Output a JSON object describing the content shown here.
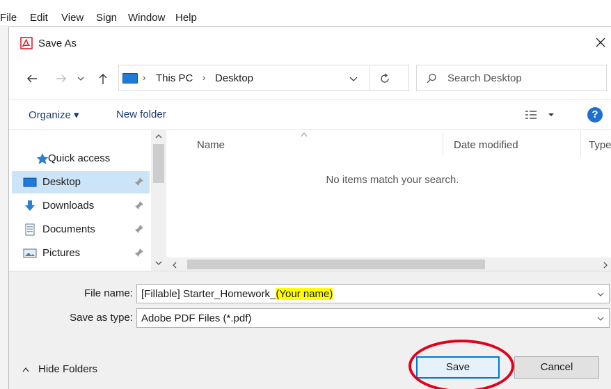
{
  "app_menu": [
    "File",
    "Edit",
    "View",
    "Sign",
    "Window",
    "Help"
  ],
  "dialog": {
    "title": "Save As",
    "icon": "pdf-icon"
  },
  "address": {
    "crumbs": [
      "This PC",
      "Desktop"
    ],
    "search_placeholder": "Search Desktop"
  },
  "toolbar": {
    "organize": "Organize ▾",
    "new_folder": "New folder"
  },
  "nav_pane": {
    "items": [
      {
        "label": "Quick access",
        "icon": "star-icon"
      },
      {
        "label": "Desktop",
        "icon": "desktop-folder-icon",
        "selected": true
      },
      {
        "label": "Downloads",
        "icon": "download-arrow-icon"
      },
      {
        "label": "Documents",
        "icon": "documents-icon"
      },
      {
        "label": "Pictures",
        "icon": "pictures-icon"
      }
    ]
  },
  "file_list": {
    "columns": [
      "Name",
      "Date modified",
      "Type"
    ],
    "empty_message": "No items match your search."
  },
  "form": {
    "file_name_label": "File name:",
    "file_name_prefix": "[Fillable] Starter_Homework_",
    "file_name_highlight": "(Your name)",
    "save_type_label": "Save as type:",
    "save_type_value": "Adobe PDF Files (*.pdf)"
  },
  "footer": {
    "hide_folders": "Hide Folders",
    "save": "Save",
    "cancel": "Cancel"
  },
  "colors": {
    "accent": "#0078d7",
    "highlight": "#ffff00",
    "annotation": "#e3001b",
    "selection": "#cce4f7"
  }
}
